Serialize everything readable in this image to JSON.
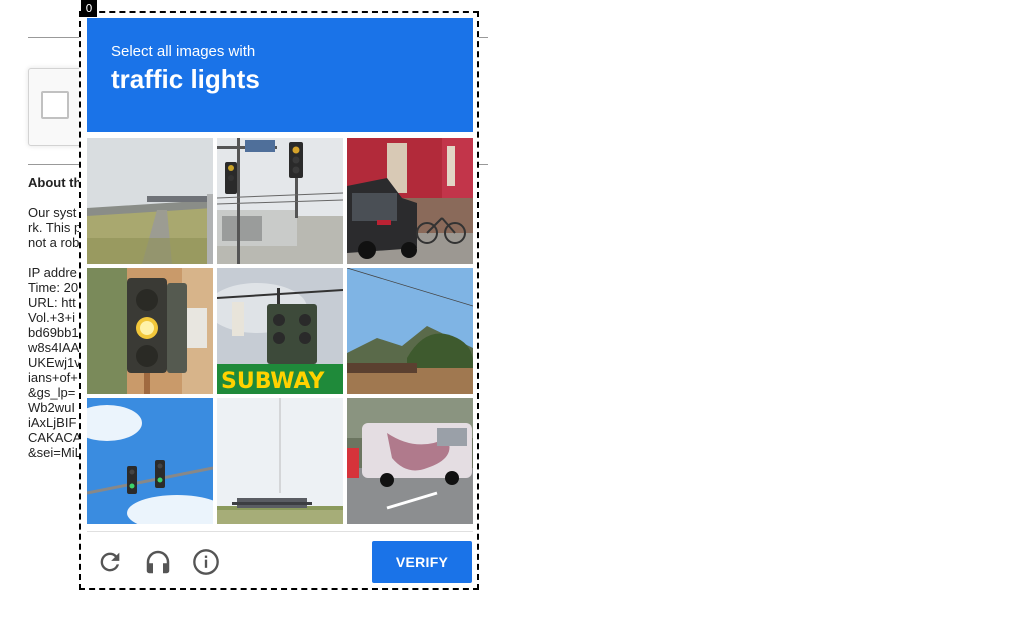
{
  "background_page": {
    "about_title": "About th",
    "about_lines": [
      "Our syst",
      "rk. This p",
      "not a rob",
      "",
      "IP addre",
      "Time: 20",
      "URL: htt",
      "Vol.+3+i",
      "bd69bb1",
      "w8s4IAA",
      "UKEwj1v",
      "ians+of+",
      "&gs_lp=",
      "Wb2wuI",
      "iAxLjBIF",
      "CAKACA",
      "&sei=MiL"
    ]
  },
  "challenge": {
    "counter": "0",
    "instruction_prefix": "Select all images with",
    "target_object": "traffic lights",
    "tiles": [
      {
        "id": "tile-1",
        "scene": "highway overpass with grass"
      },
      {
        "id": "tile-2",
        "scene": "traffic lights at intersection"
      },
      {
        "id": "tile-3",
        "scene": "parked car with bicycle"
      },
      {
        "id": "tile-4",
        "scene": "traffic light close-up yellow"
      },
      {
        "id": "tile-5",
        "scene": "traffic light with subway sign"
      },
      {
        "id": "tile-6",
        "scene": "mountains and tree"
      },
      {
        "id": "tile-7",
        "scene": "traffic lights against sky"
      },
      {
        "id": "tile-8",
        "scene": "empty road with building"
      },
      {
        "id": "tile-9",
        "scene": "truck on road"
      }
    ],
    "subway_sign_text": "SUBWAY",
    "verify_label": "VERIFY",
    "icons": {
      "reload": "reload-icon",
      "audio": "headphones-icon",
      "info": "info-icon"
    },
    "colors": {
      "accent": "#1a73e8"
    }
  }
}
